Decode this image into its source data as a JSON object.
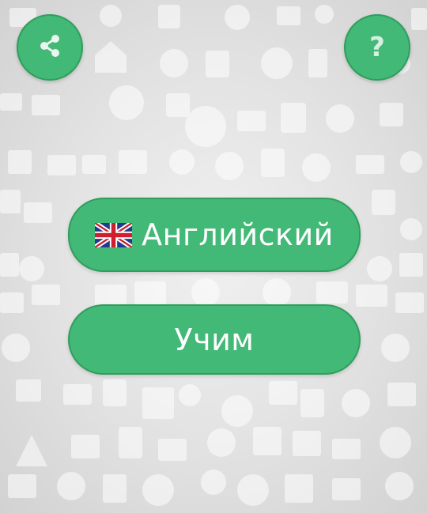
{
  "buttons": {
    "language_label": "Английский",
    "language_flag": "uk-flag-icon",
    "learn_label": "Учим",
    "share_icon": "share-icon",
    "help_symbol": "?"
  },
  "colors": {
    "accent": "#43b977",
    "accent_border": "#2f9e5d",
    "background": "#e3e3e3"
  }
}
